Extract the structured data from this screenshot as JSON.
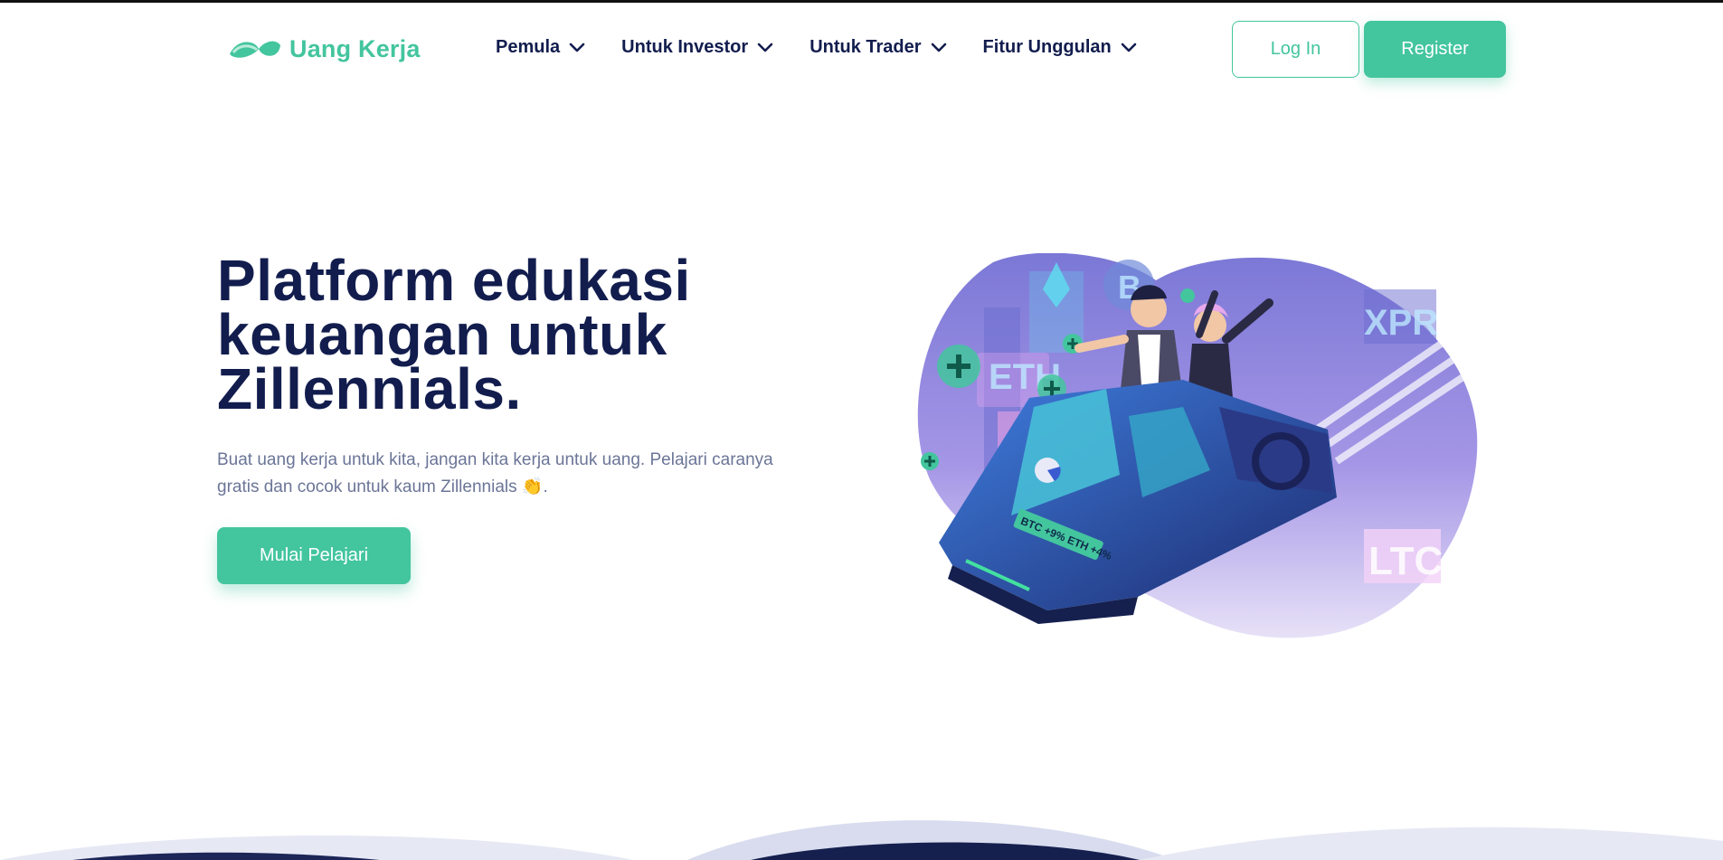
{
  "brand": {
    "name": "Uang Kerja",
    "color": "#43c59e",
    "logo_icon": "infinity-leaf-logo"
  },
  "nav": {
    "items": [
      {
        "label": "Pemula",
        "icon": "chevron-down-icon"
      },
      {
        "label": "Untuk Investor",
        "icon": "chevron-down-icon"
      },
      {
        "label": "Untuk Trader",
        "icon": "chevron-down-icon"
      },
      {
        "label": "Fitur Unggulan",
        "icon": "chevron-down-icon"
      }
    ],
    "login_label": "Log In",
    "register_label": "Register"
  },
  "hero": {
    "title_line1": "Platform edukasi",
    "title_line2": "keuangan untuk",
    "title_line3": "Zillennials.",
    "subtitle_line1": "Buat uang kerja untuk kita, jangan kita kerja untuk uang. Pelajari caranya",
    "subtitle_line2": "gratis dan cocok untuk kaum Zillennials 👏.",
    "cta_label": "Mulai Pelajari"
  },
  "illustration": {
    "ticker_text": "BTC +9% ETH +4%",
    "coin_labels": [
      "ETH",
      "XPR",
      "LTC",
      "B"
    ]
  },
  "colors": {
    "primary": "#43c59e",
    "navy": "#121d4e",
    "muted": "#6b7597",
    "blob": "#9a8fe0"
  }
}
